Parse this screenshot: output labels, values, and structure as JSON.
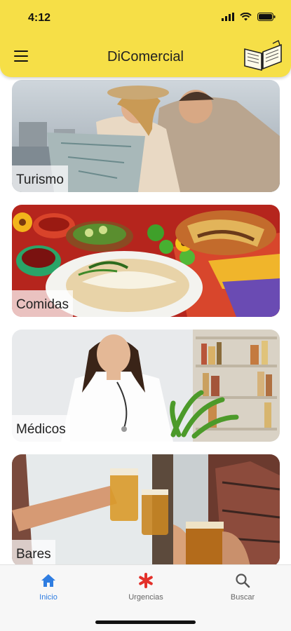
{
  "status": {
    "time": "4:12"
  },
  "header": {
    "title": "DiComercial"
  },
  "colors": {
    "header_bg": "#f6df47",
    "tab_active": "#2f7de1",
    "urgencias_icon": "#e3302a",
    "tab_inactive": "#666666"
  },
  "categories": [
    {
      "label": "Turismo",
      "image": "couple-with-map-photo"
    },
    {
      "label": "Comidas",
      "image": "mexican-food-photo"
    },
    {
      "label": "Médicos",
      "image": "doctor-photo"
    },
    {
      "label": "Bares",
      "image": "beer-toast-photo"
    }
  ],
  "tabs": [
    {
      "label": "Inicio",
      "icon": "home-icon",
      "active": true
    },
    {
      "label": "Urgencias",
      "icon": "asterisk-icon",
      "active": false
    },
    {
      "label": "Buscar",
      "icon": "search-icon",
      "active": false
    }
  ]
}
